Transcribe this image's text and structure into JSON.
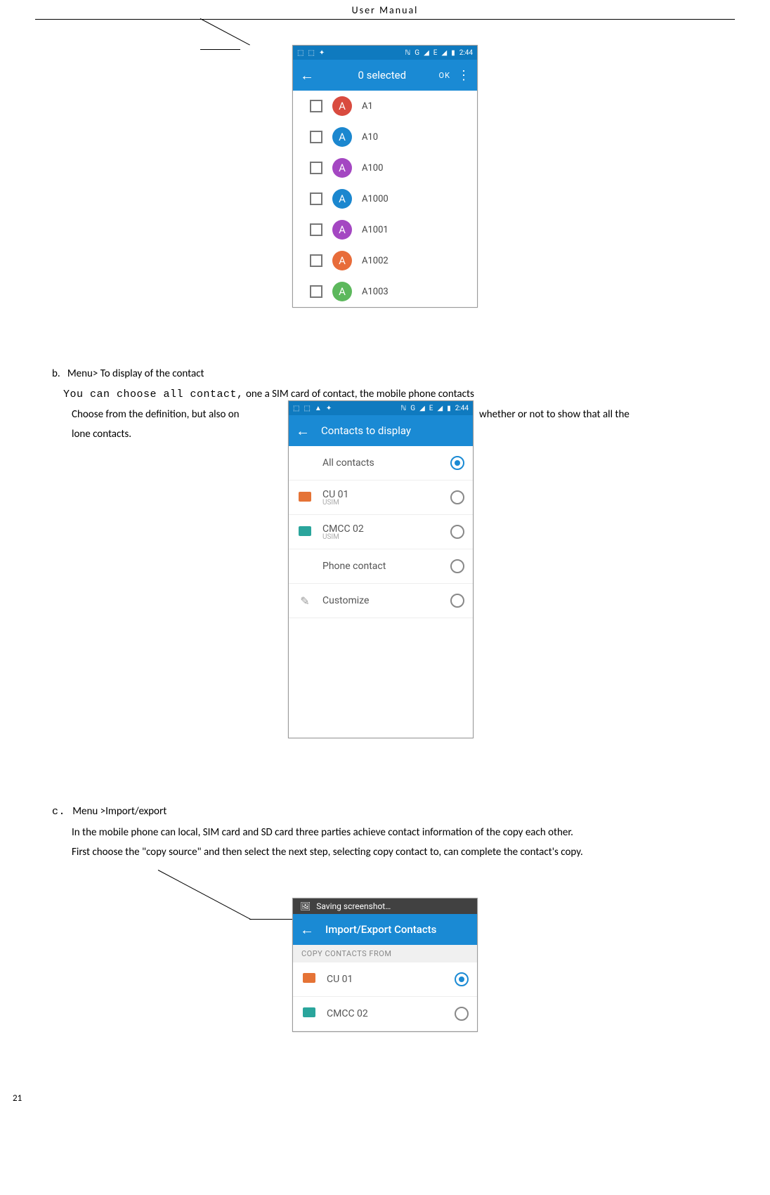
{
  "header": {
    "title": "User    Manual"
  },
  "page_number": "21",
  "screenshot1": {
    "statusbar": {
      "time": "2:44",
      "carrier": "G",
      "extra": "E"
    },
    "appbar": {
      "title": "0 selected",
      "action": "OK",
      "more": ":"
    },
    "contacts": [
      {
        "initial": "A",
        "name": "A1",
        "color": "#d94b3f"
      },
      {
        "initial": "A",
        "name": "A10",
        "color": "#1b87cf"
      },
      {
        "initial": "A",
        "name": "A100",
        "color": "#a447c2"
      },
      {
        "initial": "A",
        "name": "A1000",
        "color": "#1b87cf"
      },
      {
        "initial": "A",
        "name": "A1001",
        "color": "#a447c2"
      },
      {
        "initial": "A",
        "name": "A1002",
        "color": "#e86c3a"
      },
      {
        "initial": "A",
        "name": "A1003",
        "color": "#5cb85c"
      }
    ]
  },
  "section_b": {
    "label": "b.",
    "title_bold": "Menu>",
    "title_rest": " To display of the contact",
    "line1_mono": "You can choose all contact,",
    "line1_rest": " one a SIM card of contact, the mobile phone contacts",
    "line2_left": "Choose from the definition, but also on",
    "line2_right": " whether or not to show that all the",
    "line3": "lone contacts."
  },
  "screenshot2": {
    "statusbar": {
      "time": "2:44",
      "carrier": "G",
      "extra": "E"
    },
    "appbar": {
      "title": "Contacts to display"
    },
    "rows": [
      {
        "kind": "all",
        "label": "All contacts",
        "sub": "",
        "selected": true
      },
      {
        "kind": "sim1",
        "label": "CU 01",
        "sub": "USIM",
        "selected": false
      },
      {
        "kind": "sim2",
        "label": "CMCC 02",
        "sub": "USIM",
        "selected": false
      },
      {
        "kind": "phone",
        "label": "Phone contact",
        "sub": "",
        "selected": false
      },
      {
        "kind": "cust",
        "label": "Customize",
        "sub": "",
        "selected": false
      }
    ]
  },
  "section_c": {
    "label": "c.",
    "title": "Menu >Import/export",
    "p1": "In the mobile phone can local, SIM card and SD card three parties achieve contact information of the copy each other.",
    "p2": "First choose the \"copy source\" and then select the next step, selecting copy contact to, can complete the contact's copy."
  },
  "screenshot3": {
    "saving": "Saving screenshot…",
    "appbar": {
      "title": "Import/Export Contacts"
    },
    "section": "COPY CONTACTS FROM",
    "rows": [
      {
        "kind": "sim1",
        "label": "CU 01",
        "selected": true
      },
      {
        "kind": "sim2",
        "label": "CMCC 02",
        "selected": false
      }
    ]
  }
}
